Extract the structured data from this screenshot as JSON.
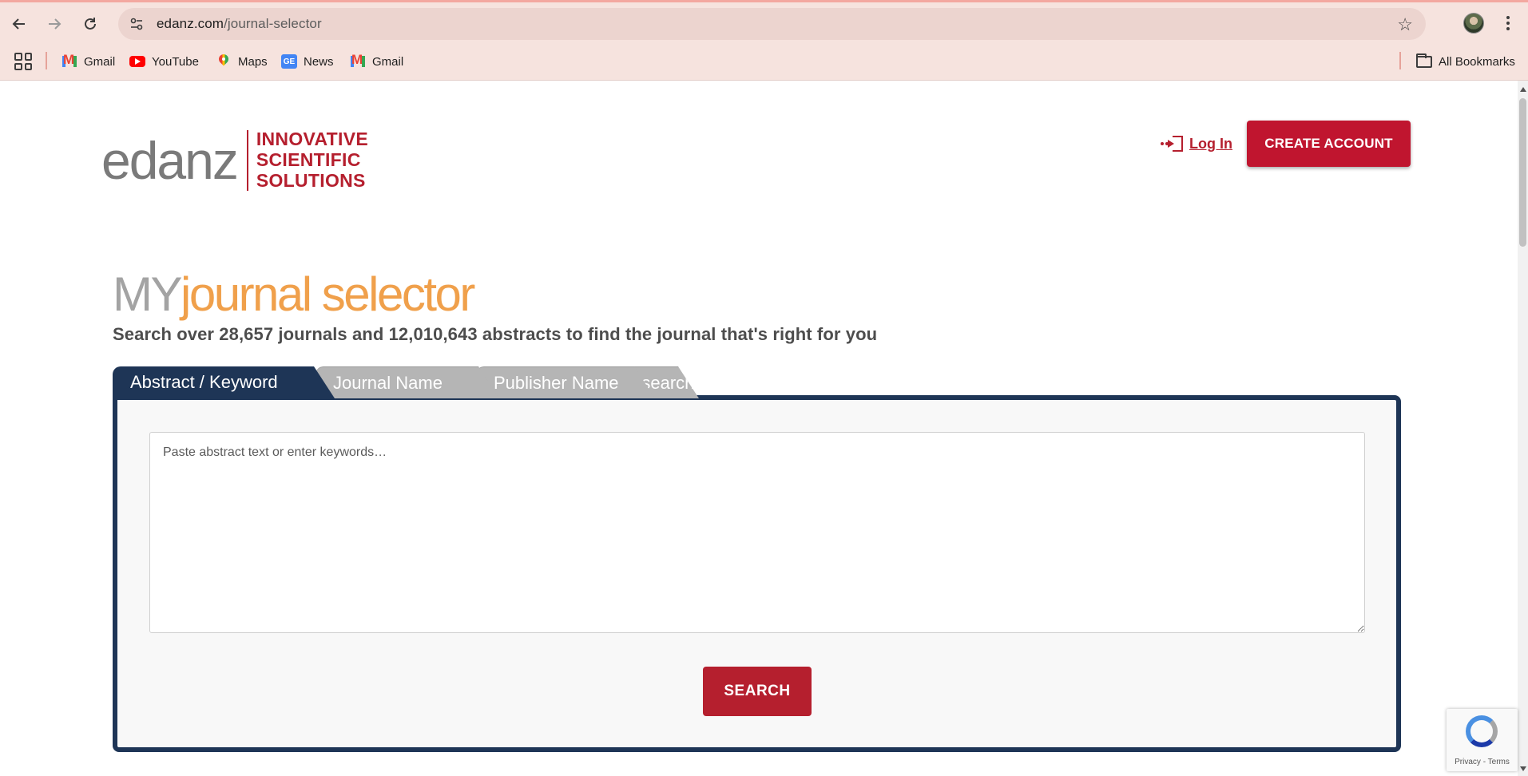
{
  "browser": {
    "url_domain": "edanz.com",
    "url_path": "/journal-selector",
    "bookmarks": [
      {
        "label": "Gmail",
        "icon": "gmail-icon"
      },
      {
        "label": "YouTube",
        "icon": "youtube-icon"
      },
      {
        "label": "Maps",
        "icon": "maps-icon"
      },
      {
        "label": "News",
        "icon": "news-icon"
      },
      {
        "label": "Gmail",
        "icon": "gmail-icon"
      }
    ],
    "all_bookmarks_label": "All Bookmarks"
  },
  "header": {
    "logo_word": "edanz",
    "logo_tagline": [
      "INNOVATIVE",
      "SCIENTIFIC",
      "SOLUTIONS"
    ],
    "login_label": "Log In",
    "create_account_label": "CREATE ACCOUNT"
  },
  "main": {
    "title_my": "MY",
    "title_rest": "journal selector",
    "subtitle": "Search over 28,657 journals and 12,010,643 abstracts to find the journal that's right for you",
    "tabs": [
      {
        "label": "Abstract / Keyword",
        "active": true
      },
      {
        "label": "Journal Name",
        "active": false
      },
      {
        "label": "Publisher Name",
        "active": false
      },
      {
        "label": "Field of Research",
        "active": false
      }
    ],
    "abstract_placeholder": "Paste abstract text or enter keywords…",
    "search_label": "SEARCH"
  },
  "recaptcha": {
    "footer": "Privacy - Terms"
  },
  "colors": {
    "brand_red": "#b51f2e",
    "navy": "#1e3556",
    "title_orange": "#f0a04b",
    "chrome_bg": "#f6e3de"
  }
}
